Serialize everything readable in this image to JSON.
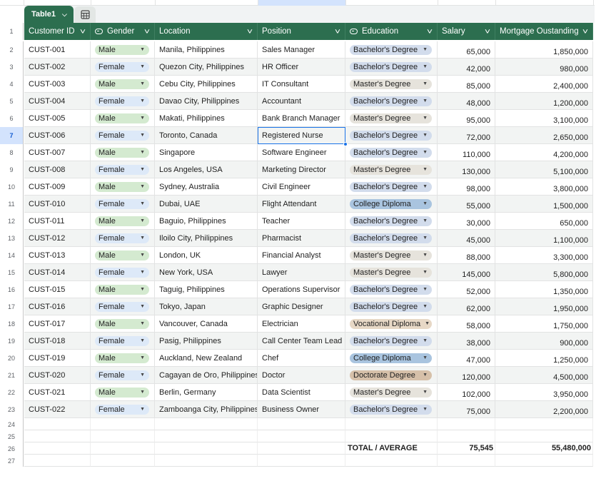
{
  "table": {
    "name": "Table1"
  },
  "columns": [
    {
      "key": "id",
      "label": "Customer ID",
      "chip_icon": false
    },
    {
      "key": "gender",
      "label": "Gender",
      "chip_icon": true
    },
    {
      "key": "location",
      "label": "Location",
      "chip_icon": false
    },
    {
      "key": "position",
      "label": "Position",
      "chip_icon": false
    },
    {
      "key": "education",
      "label": "Education",
      "chip_icon": true
    },
    {
      "key": "salary",
      "label": "Salary",
      "chip_icon": false
    },
    {
      "key": "mortgage",
      "label": "Mortgage Oustanding",
      "chip_icon": false
    }
  ],
  "chip_colors": {
    "Male": "#d4ead0",
    "Female": "#dde9f8",
    "Bachelor's Degree": "#d2dcec",
    "Master's Degree": "#e6e3dc",
    "College Diploma": "#a9c4df",
    "Vocational Diploma": "#e7d8c6",
    "Doctorate Degree": "#d6c0a9"
  },
  "header_row_number": "1",
  "active_row": "7",
  "rows": [
    {
      "n": "2",
      "id": "CUST-001",
      "gender": "Male",
      "location": "Manila, Philippines",
      "position": "Sales Manager",
      "education": "Bachelor's Degree",
      "salary": "65,000",
      "mortgage": "1,850,000"
    },
    {
      "n": "3",
      "id": "CUST-002",
      "gender": "Female",
      "location": "Quezon City, Philippines",
      "position": "HR Officer",
      "education": "Bachelor's Degree",
      "salary": "42,000",
      "mortgage": "980,000"
    },
    {
      "n": "4",
      "id": "CUST-003",
      "gender": "Male",
      "location": "Cebu City, Philippines",
      "position": "IT Consultant",
      "education": "Master's Degree",
      "salary": "85,000",
      "mortgage": "2,400,000"
    },
    {
      "n": "5",
      "id": "CUST-004",
      "gender": "Female",
      "location": "Davao City, Philippines",
      "position": "Accountant",
      "education": "Bachelor's Degree",
      "salary": "48,000",
      "mortgage": "1,200,000"
    },
    {
      "n": "6",
      "id": "CUST-005",
      "gender": "Male",
      "location": "Makati, Philippines",
      "position": "Bank Branch Manager",
      "education": "Master's Degree",
      "salary": "95,000",
      "mortgage": "3,100,000"
    },
    {
      "n": "7",
      "id": "CUST-006",
      "gender": "Female",
      "location": "Toronto, Canada",
      "position": "Registered Nurse",
      "education": "Bachelor's Degree",
      "salary": "72,000",
      "mortgage": "2,650,000"
    },
    {
      "n": "8",
      "id": "CUST-007",
      "gender": "Male",
      "location": "Singapore",
      "position": "Software Engineer",
      "education": "Bachelor's Degree",
      "salary": "110,000",
      "mortgage": "4,200,000"
    },
    {
      "n": "9",
      "id": "CUST-008",
      "gender": "Female",
      "location": "Los Angeles, USA",
      "position": "Marketing Director",
      "education": "Master's Degree",
      "salary": "130,000",
      "mortgage": "5,100,000"
    },
    {
      "n": "10",
      "id": "CUST-009",
      "gender": "Male",
      "location": "Sydney, Australia",
      "position": "Civil Engineer",
      "education": "Bachelor's Degree",
      "salary": "98,000",
      "mortgage": "3,800,000"
    },
    {
      "n": "11",
      "id": "CUST-010",
      "gender": "Female",
      "location": "Dubai, UAE",
      "position": "Flight Attendant",
      "education": "College Diploma",
      "salary": "55,000",
      "mortgage": "1,500,000"
    },
    {
      "n": "12",
      "id": "CUST-011",
      "gender": "Male",
      "location": "Baguio, Philippines",
      "position": "Teacher",
      "education": "Bachelor's Degree",
      "salary": "30,000",
      "mortgage": "650,000"
    },
    {
      "n": "13",
      "id": "CUST-012",
      "gender": "Female",
      "location": "Iloilo City, Philippines",
      "position": "Pharmacist",
      "education": "Bachelor's Degree",
      "salary": "45,000",
      "mortgage": "1,100,000"
    },
    {
      "n": "14",
      "id": "CUST-013",
      "gender": "Male",
      "location": "London, UK",
      "position": "Financial Analyst",
      "education": "Master's Degree",
      "salary": "88,000",
      "mortgage": "3,300,000"
    },
    {
      "n": "15",
      "id": "CUST-014",
      "gender": "Female",
      "location": "New York, USA",
      "position": "Lawyer",
      "education": "Master's Degree",
      "salary": "145,000",
      "mortgage": "5,800,000"
    },
    {
      "n": "16",
      "id": "CUST-015",
      "gender": "Male",
      "location": "Taguig, Philippines",
      "position": "Operations Supervisor",
      "education": "Bachelor's Degree",
      "salary": "52,000",
      "mortgage": "1,350,000"
    },
    {
      "n": "17",
      "id": "CUST-016",
      "gender": "Female",
      "location": "Tokyo, Japan",
      "position": "Graphic Designer",
      "education": "Bachelor's Degree",
      "salary": "62,000",
      "mortgage": "1,950,000"
    },
    {
      "n": "18",
      "id": "CUST-017",
      "gender": "Male",
      "location": "Vancouver, Canada",
      "position": "Electrician",
      "education": "Vocational Diploma",
      "salary": "58,000",
      "mortgage": "1,750,000"
    },
    {
      "n": "19",
      "id": "CUST-018",
      "gender": "Female",
      "location": "Pasig, Philippines",
      "position": "Call Center Team Lead",
      "education": "Bachelor's Degree",
      "salary": "38,000",
      "mortgage": "900,000"
    },
    {
      "n": "20",
      "id": "CUST-019",
      "gender": "Male",
      "location": "Auckland, New Zealand",
      "position": "Chef",
      "education": "College Diploma",
      "salary": "47,000",
      "mortgage": "1,250,000"
    },
    {
      "n": "21",
      "id": "CUST-020",
      "gender": "Female",
      "location": "Cagayan de Oro, Philippines",
      "position": "Doctor",
      "education": "Doctorate Degree",
      "salary": "120,000",
      "mortgage": "4,500,000"
    },
    {
      "n": "22",
      "id": "CUST-021",
      "gender": "Male",
      "location": "Berlin, Germany",
      "position": "Data Scientist",
      "education": "Master's Degree",
      "salary": "102,000",
      "mortgage": "3,950,000"
    },
    {
      "n": "23",
      "id": "CUST-022",
      "gender": "Female",
      "location": "Zamboanga City, Philippines",
      "position": "Business Owner",
      "education": "Bachelor's Degree",
      "salary": "75,000",
      "mortgage": "2,200,000"
    }
  ],
  "empty_rows": [
    "24",
    "25",
    "27"
  ],
  "total_row": {
    "n": "26",
    "label": "TOTAL / AVERAGE",
    "salary": "75,545",
    "mortgage": "55,480,000"
  },
  "colors": {
    "header_green": "#2c6e4f",
    "stripe": "#f2f4f3",
    "selection_blue": "#1a73e8"
  }
}
